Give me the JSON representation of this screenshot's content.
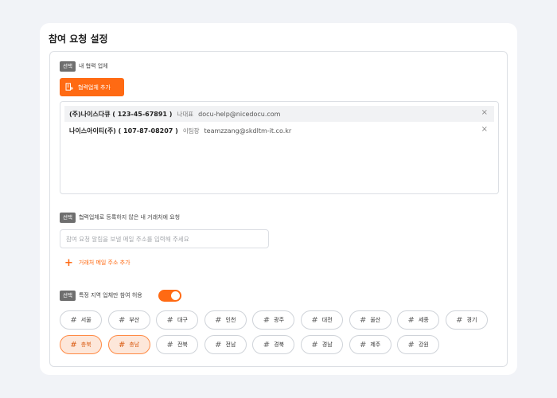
{
  "title": "참여 요청 설정",
  "badge": "선택",
  "partners_section": {
    "label": "내 협력 업체",
    "add_button": "협력업체 추가",
    "items": [
      {
        "name": "(주)나이스다큐 ( 123-45-67891 )",
        "rep": "나대표",
        "email": "docu-help@nicedocu.com"
      },
      {
        "name": "나이스아이티(주) ( 107-87-08207 )",
        "rep": "이팀장",
        "email": "teamzzang@skdltm-it.co.kr"
      }
    ]
  },
  "email_section": {
    "label": "협력업체로 등록하지 않은 내 거래처에 요청",
    "placeholder": "참여 요청 알림을 보낼 메일 주소를 입력해 주세요",
    "add_link": "거래처 메일 주소 추가"
  },
  "region_section": {
    "label": "특정 지역 업체만 참여 허용",
    "toggle_on": true,
    "regions": [
      {
        "name": "서울",
        "selected": false
      },
      {
        "name": "부산",
        "selected": false
      },
      {
        "name": "대구",
        "selected": false
      },
      {
        "name": "인천",
        "selected": false
      },
      {
        "name": "광주",
        "selected": false
      },
      {
        "name": "대전",
        "selected": false
      },
      {
        "name": "울산",
        "selected": false
      },
      {
        "name": "세종",
        "selected": false
      },
      {
        "name": "경기",
        "selected": false
      },
      {
        "name": "충북",
        "selected": true
      },
      {
        "name": "충남",
        "selected": true
      },
      {
        "name": "전북",
        "selected": false
      },
      {
        "name": "전남",
        "selected": false
      },
      {
        "name": "경북",
        "selected": false
      },
      {
        "name": "경남",
        "selected": false
      },
      {
        "name": "제주",
        "selected": false
      },
      {
        "name": "강원",
        "selected": false
      }
    ]
  },
  "colors": {
    "accent": "#ff6a13",
    "selected_bg": "#fde7da"
  },
  "icons": {
    "add_partner": "building-plus-icon",
    "close": "close-icon",
    "plus": "plus-icon",
    "hash": "hash-icon"
  }
}
